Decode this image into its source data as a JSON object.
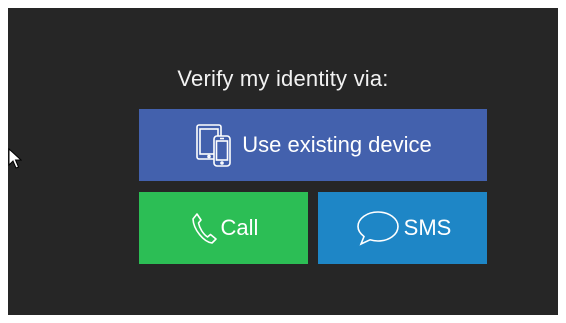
{
  "prompt": {
    "title": "Verify my identity via:"
  },
  "buttons": {
    "device": {
      "label": "Use existing device",
      "icon": "devices-icon",
      "color": "#4361ad"
    },
    "call": {
      "label": "Call",
      "icon": "phone-icon",
      "color": "#2cbe55"
    },
    "sms": {
      "label": "SMS",
      "icon": "speech-bubble-icon",
      "color": "#1e86c6"
    }
  },
  "colors": {
    "background": "#262626",
    "text": "#f2f2f2"
  },
  "cursor": {
    "icon": "mouse-pointer-icon"
  }
}
